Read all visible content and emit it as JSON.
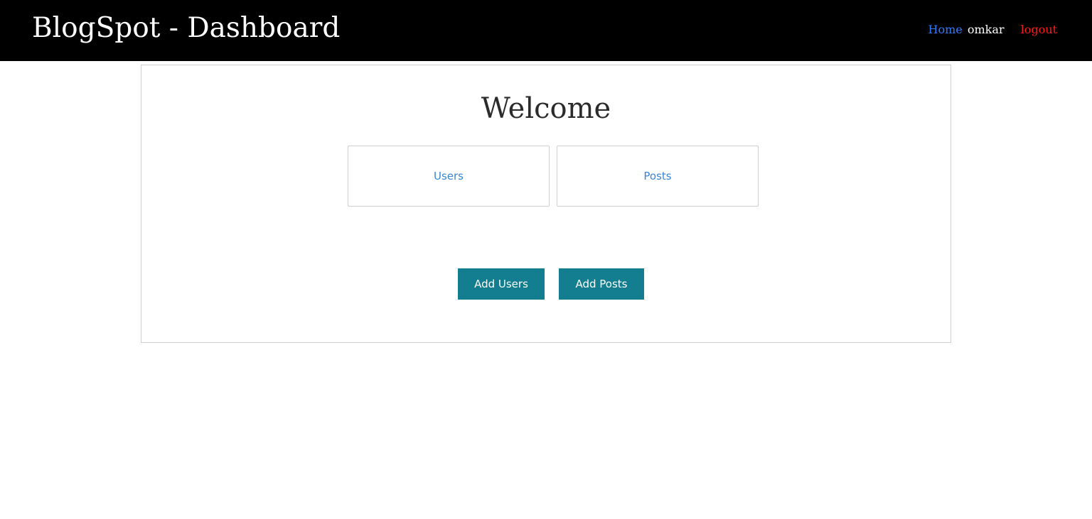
{
  "header": {
    "brand": "BlogSpot - Dashboard",
    "nav": {
      "home": "Home",
      "username": "omkar",
      "logout": "logout"
    }
  },
  "main": {
    "heading": "Welcome",
    "cards": [
      {
        "label": "Users"
      },
      {
        "label": "Posts"
      }
    ],
    "buttons": {
      "add_users": "Add Users",
      "add_posts": "Add Posts"
    }
  },
  "colors": {
    "header_bg": "#000000",
    "home_link": "#2f7bff",
    "logout_link": "#ff1a1a",
    "card_link": "#3a86d6",
    "button_bg": "#127e8f"
  }
}
